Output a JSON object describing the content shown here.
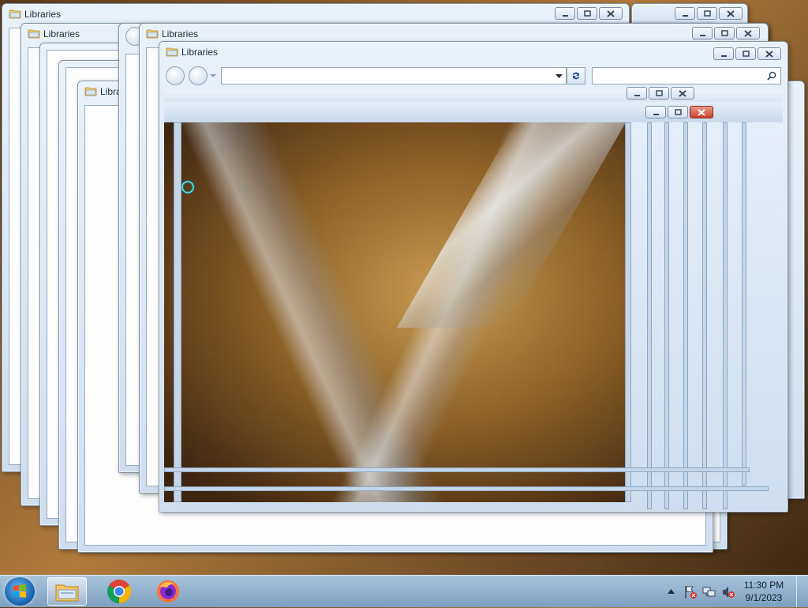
{
  "window_title": "Libraries",
  "front_window": {
    "title": "Libraries",
    "address_value": "",
    "search_value": ""
  },
  "taskbar": {
    "pinned": [
      "windows-explorer",
      "google-chrome",
      "firefox"
    ],
    "clock_time": "11:30 PM",
    "clock_date": "9/1/2023"
  },
  "colors": {
    "title_bar": "#dce8f4",
    "taskbar": "#8fb0cf",
    "close_red": "#c7412d"
  }
}
